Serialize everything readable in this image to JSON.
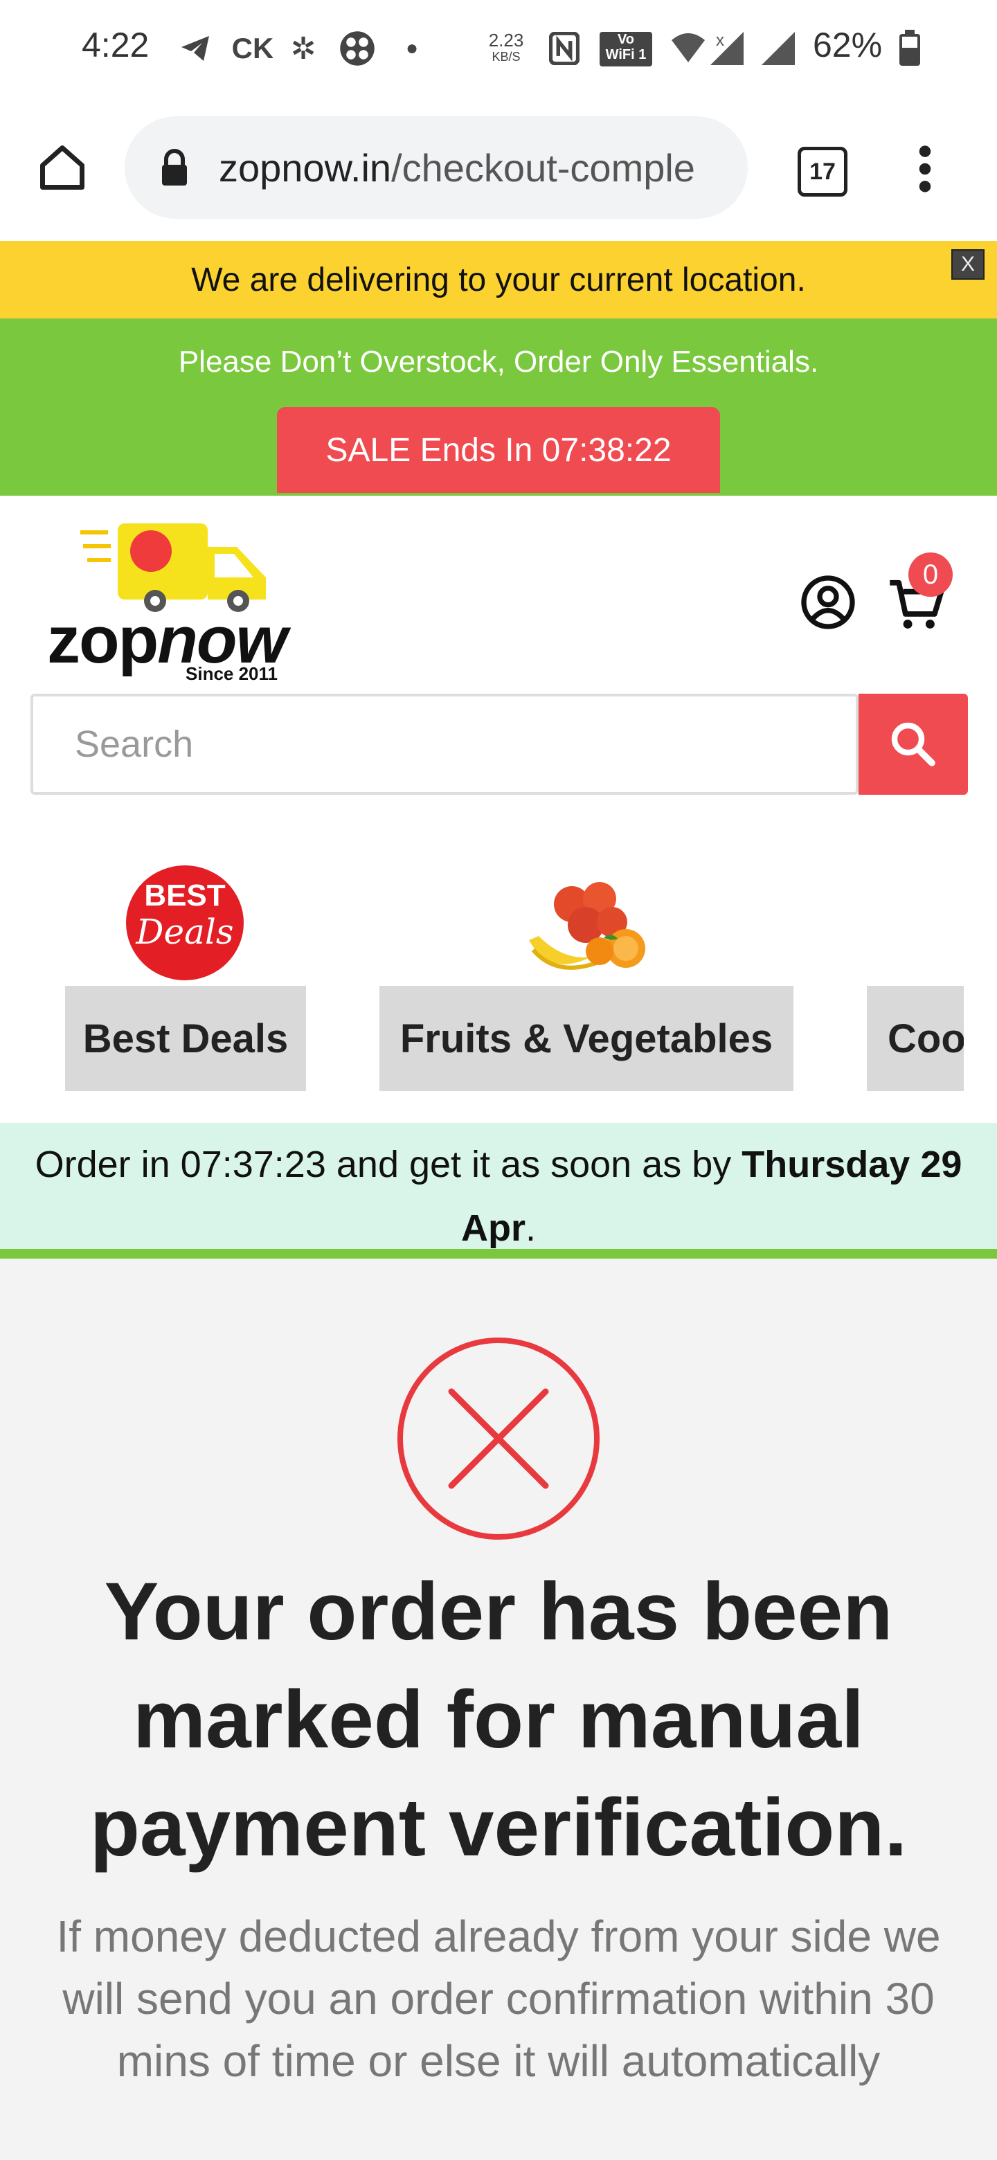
{
  "status_bar": {
    "time": "4:22",
    "carrier_badge": "CK",
    "net_speed_value": "2.23",
    "net_speed_unit": "KB/S",
    "wifi_badge_top": "Vo",
    "wifi_badge_bottom": "WiFi 1",
    "battery": "62%"
  },
  "browser": {
    "url_host": "zopnow.in",
    "url_path": "/checkout-comple",
    "tab_count": "17"
  },
  "banners": {
    "location_notice": "We are delivering to your current location.",
    "close_label": "X",
    "overstock_notice": "Please Don’t Overstock, Order Only Essentials.",
    "sale_label": "SALE Ends In 07:38:22"
  },
  "header": {
    "logo_text_plain": "zop",
    "logo_text_italic": "now",
    "logo_since": "Since 2011",
    "cart_count": "0",
    "search_placeholder": "Search"
  },
  "categories": [
    {
      "label": "Best Deals",
      "icon": "best-deals-badge",
      "badge_top": "BEST",
      "badge_bottom": "Deals"
    },
    {
      "label": "Fruits & Vegetables",
      "icon": "fruits-icon"
    },
    {
      "label": "Coo",
      "icon": ""
    }
  ],
  "delivery_strip": {
    "prefix": "Order in 07:37:23 and get it as soon as by ",
    "day": "Thursday 29 Apr",
    "suffix": "."
  },
  "main": {
    "title": "Your order has been marked for manual payment verification.",
    "subtitle": "If money deducted already from your side we will send you an order confirmation within 30 mins of time or else it will automatically"
  },
  "colors": {
    "accent_red": "#ef4b50",
    "yellow_banner": "#fbd22f",
    "green_banner": "#7ac83d",
    "strip_bg": "#d9f5e9"
  }
}
